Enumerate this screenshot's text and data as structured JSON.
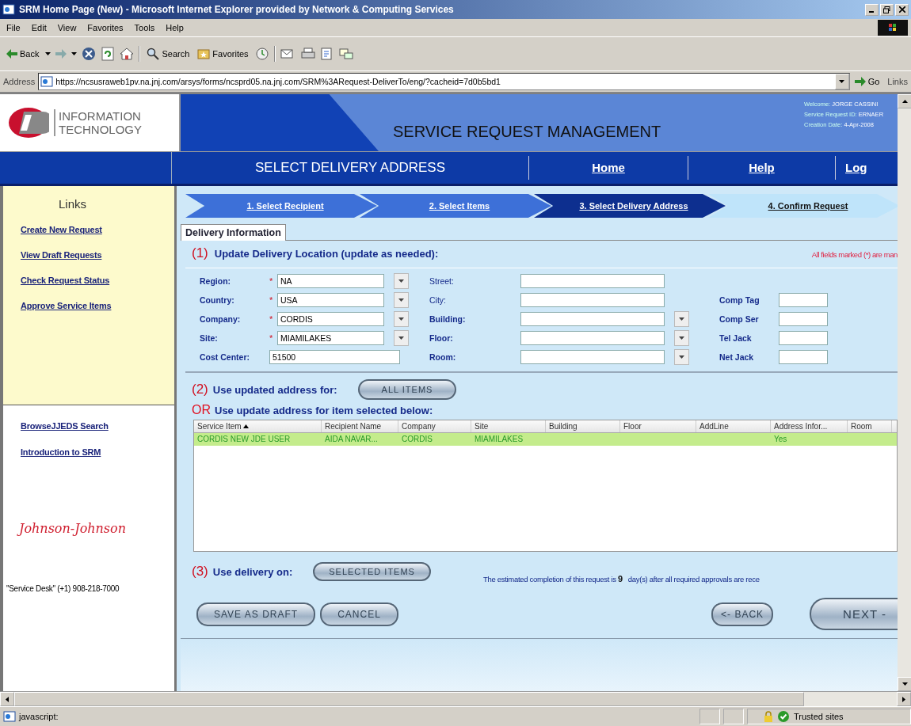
{
  "window": {
    "title": "SRM Home Page (New) - Microsoft Internet Explorer provided by Network & Computing Services"
  },
  "menu": [
    "File",
    "Edit",
    "View",
    "Favorites",
    "Tools",
    "Help"
  ],
  "toolbar": {
    "back": "Back",
    "search": "Search",
    "favorites": "Favorites"
  },
  "address": {
    "label": "Address",
    "url": "https://ncsusraweb1pv.na.jnj.com/arsys/forms/ncsprd05.na.jnj.com/SRM%3ARequest-DeliverTo/eng/?cacheid=7d0b5bd1",
    "go": "Go",
    "links": "Links"
  },
  "header": {
    "logo_lines": [
      "INFORMATION",
      "TECHNOLOGY"
    ],
    "title": "SERVICE REQUEST MANAGEMENT",
    "info": [
      {
        "label": "Welcome:",
        "value": "JORGE CASSINI"
      },
      {
        "label": "Service Request ID:",
        "value": "ERNAER"
      },
      {
        "label": "Creation Date:",
        "value": "4-Apr-2008"
      }
    ]
  },
  "nav": {
    "page_title": "SELECT DELIVERY ADDRESS",
    "links": [
      "Home",
      "Help",
      "Log"
    ]
  },
  "sidebar": {
    "heading": "Links",
    "primary_links": [
      "Create New Request",
      "View Draft Requests",
      "Check Request Status",
      "Approve Service Items"
    ],
    "secondary_links": [
      "BrowseJJEDS Search",
      "Introduction to SRM"
    ],
    "brand": "Johnson-Johnson",
    "service_desk": "\"Service Desk\" (+1) 908-218-7000"
  },
  "steps": [
    {
      "label": "1. Select Recipient",
      "done": true,
      "selected": false
    },
    {
      "label": "2. Select Items",
      "done": true,
      "selected": false
    },
    {
      "label": "3. Select Delivery Address",
      "done": false,
      "selected": true
    },
    {
      "label": "4. Confirm Request",
      "done": false,
      "selected": false
    }
  ],
  "tab": {
    "label": "Delivery Information",
    "selected": true
  },
  "section1": {
    "number": "(1)",
    "title": "Update Delivery Location (update as needed):",
    "note": "All fields marked (*) are man"
  },
  "location_fields": [
    {
      "label": "Region:",
      "required_mark": "*",
      "value": "NA",
      "kind": "dropdown"
    },
    {
      "label": "Country:",
      "required_mark": "*",
      "value": "USA",
      "kind": "dropdown"
    },
    {
      "label": "Company:",
      "required_mark": "*",
      "value": "CORDIS",
      "kind": "dropdown"
    },
    {
      "label": "Site:",
      "required_mark": "*",
      "value": "MIAMILAKES",
      "kind": "dropdown"
    },
    {
      "label": "Cost Center:",
      "value": "51500",
      "kind": "text"
    }
  ],
  "address_fields": [
    {
      "label": "Street:",
      "bold": false,
      "kind": "text"
    },
    {
      "label": "City:",
      "bold": false,
      "kind": "text"
    },
    {
      "label": "Building:",
      "bold": true,
      "kind": "dropdown"
    },
    {
      "label": "Floor:",
      "bold": true,
      "kind": "dropdown"
    },
    {
      "label": "Room:",
      "bold": true,
      "kind": "dropdown"
    }
  ],
  "equipment_fields": [
    {
      "label": "Comp Tag"
    },
    {
      "label": "Comp Ser"
    },
    {
      "label": "Tel Jack"
    },
    {
      "label": "Net Jack"
    }
  ],
  "section2": {
    "number": "(2)",
    "text": "Use updated address for:",
    "button": "ALL ITEMS"
  },
  "section_or": {
    "prefix": "OR",
    "text": "Use update address for item selected below:"
  },
  "table": {
    "columns": [
      {
        "label": "Service Item",
        "sorted": true
      },
      {
        "label": "Recipient Name",
        "sorted": false
      },
      {
        "label": "Company",
        "sorted": false
      },
      {
        "label": "Site",
        "sorted": false
      },
      {
        "label": "Building",
        "sorted": false
      },
      {
        "label": "Floor",
        "sorted": false
      },
      {
        "label": "AddLine",
        "sorted": false
      },
      {
        "label": "Address Infor...",
        "sorted": false
      },
      {
        "label": "Room",
        "sorted": false
      }
    ],
    "rows": [
      {
        "selected": true,
        "cells": [
          "CORDIS NEW JDE USER",
          "AIDA NAVAR...",
          "CORDIS",
          "MIAMILAKES",
          null,
          null,
          null,
          "Yes",
          null
        ]
      }
    ]
  },
  "section3": {
    "number": "(3)",
    "text": "Use delivery on:",
    "button": "SELECTED ITEMS",
    "estimate_prefix": "The estimated completion of this request is",
    "days": "9",
    "estimate_suffix": "day(s) after all required approvals are rece"
  },
  "actions": {
    "left": [
      "SAVE AS DRAFT",
      "CANCEL"
    ],
    "back": "<- BACK",
    "next": "NEXT -"
  },
  "status": {
    "text": "javascript:",
    "zone": "Trusted sites"
  }
}
